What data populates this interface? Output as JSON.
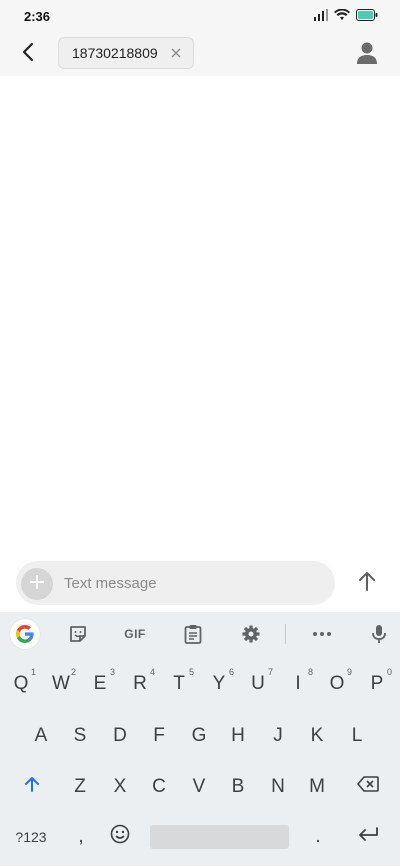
{
  "status_bar": {
    "time": "2:36"
  },
  "header": {
    "recipient": "18730218809"
  },
  "compose": {
    "placeholder": "Text message"
  },
  "keyboard": {
    "toolbar": {
      "gif": "GIF"
    },
    "row1": [
      {
        "label": "Q",
        "hint": "1"
      },
      {
        "label": "W",
        "hint": "2"
      },
      {
        "label": "E",
        "hint": "3"
      },
      {
        "label": "R",
        "hint": "4"
      },
      {
        "label": "T",
        "hint": "5"
      },
      {
        "label": "Y",
        "hint": "6"
      },
      {
        "label": "U",
        "hint": "7"
      },
      {
        "label": "I",
        "hint": "8"
      },
      {
        "label": "O",
        "hint": "9"
      },
      {
        "label": "P",
        "hint": "0"
      }
    ],
    "row2": [
      "A",
      "S",
      "D",
      "F",
      "G",
      "H",
      "J",
      "K",
      "L"
    ],
    "row3": [
      "Z",
      "X",
      "C",
      "V",
      "B",
      "N",
      "M"
    ],
    "bottom": {
      "symbols": "?123",
      "comma": ",",
      "period": "."
    },
    "colors": {
      "accent": "#1a73e8",
      "key_text": "#3c4043"
    }
  }
}
